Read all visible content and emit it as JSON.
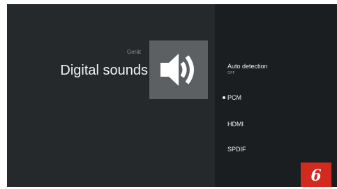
{
  "header": {
    "category": "Gerät",
    "title": "Digital sounds",
    "icon": "speaker-volume-icon"
  },
  "options": [
    {
      "label": "Auto detection",
      "sublabel": "OFF",
      "selected": false
    },
    {
      "label": "PCM",
      "selected": true
    },
    {
      "label": "HDMI",
      "selected": false
    },
    {
      "label": "SPDIF",
      "selected": false
    }
  ],
  "badge": {
    "number": "6"
  },
  "colors": {
    "background": "#26292b",
    "panel": "#1b1e20",
    "icon_tile": "#5c6063",
    "badge": "#d22a1f"
  }
}
